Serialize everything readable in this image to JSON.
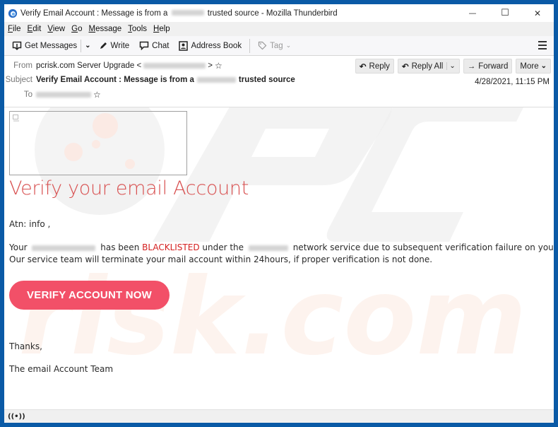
{
  "window": {
    "title_prefix": "Verify Email Account : Message is from a",
    "title_suffix": "trusted source - Mozilla Thunderbird",
    "controls": {
      "minimize": "—",
      "maximize": "☐",
      "close": "✕"
    }
  },
  "menubar": {
    "items": [
      {
        "key": "F",
        "rest": "ile"
      },
      {
        "key": "E",
        "rest": "dit"
      },
      {
        "key": "V",
        "rest": "iew"
      },
      {
        "key": "G",
        "rest": "o"
      },
      {
        "key": "M",
        "rest": "essage"
      },
      {
        "key": "T",
        "rest": "ools"
      },
      {
        "key": "H",
        "rest": "elp"
      }
    ]
  },
  "toolbar": {
    "get_messages": "Get Messages",
    "write": "Write",
    "chat": "Chat",
    "address_book": "Address Book",
    "tag": "Tag"
  },
  "header": {
    "from_label": "From",
    "from_name": "pcrisk.com Server Upgrade <",
    "from_close": ">",
    "subject_label": "Subject",
    "subject_prefix": "Verify Email Account : Message is from a",
    "subject_suffix": "trusted source",
    "to_label": "To",
    "date": "4/28/2021, 11:15 PM",
    "actions": {
      "reply": "Reply",
      "reply_all": "Reply All",
      "forward": "Forward",
      "more": "More"
    }
  },
  "message": {
    "heading": "Verify your email Account",
    "greeting": "Atn: info ,",
    "line1_a": "Your",
    "line1_b": "has been",
    "line1_red": "BLACKLISTED",
    "line1_c": "under the",
    "line1_d": "network service due to subsequent verification failure on your Account.",
    "line2": "Our service team will terminate your mail account within 24hours, if proper verification is not done.",
    "cta": "VERIFY ACCOUNT NOW",
    "thanks": "Thanks,",
    "signature": "The email Account Team"
  },
  "colors": {
    "accent_red": "#d85050",
    "cta_bg": "#f25068",
    "frame_blue": "#0a5aa6"
  }
}
